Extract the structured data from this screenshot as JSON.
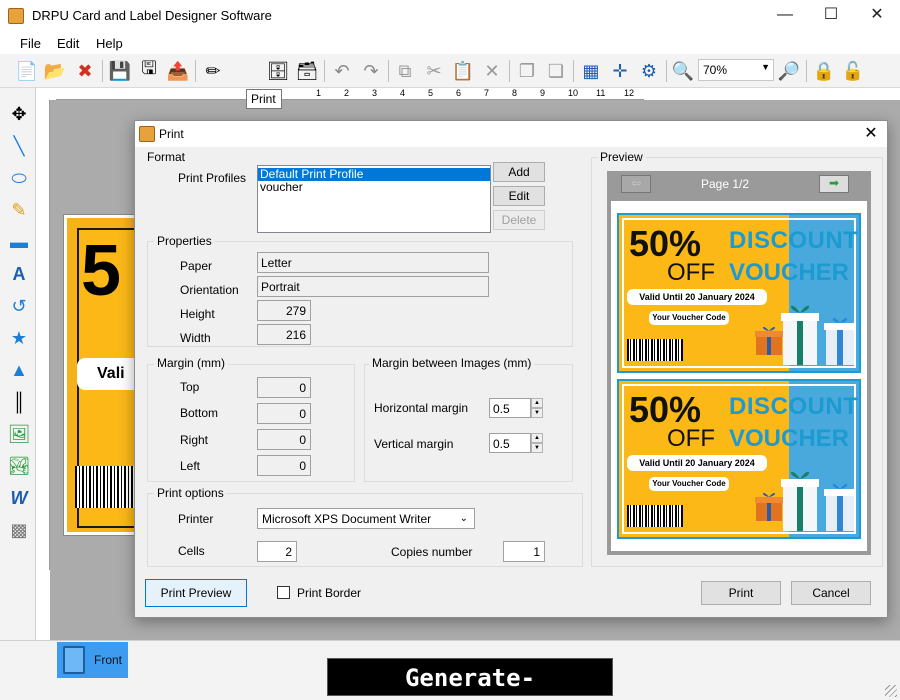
{
  "app": {
    "title": "DRPU Card and Label Designer Software",
    "minimize": "—",
    "maximize": "☐",
    "close": "✕"
  },
  "menu": [
    "File",
    "Edit",
    "Help"
  ],
  "toolbar": {
    "zoom_value": "70%",
    "tooltip": "Print",
    "icons": [
      "new-icon",
      "open-icon",
      "close-file-icon",
      "save-icon",
      "save-as-icon",
      "export-icon",
      "edit-icon",
      "print-icon",
      "database-add-icon",
      "database-icon",
      "undo-icon",
      "redo-icon",
      "copy-icon",
      "cut-icon",
      "paste-icon",
      "delete-icon",
      "bring-front-icon",
      "send-back-icon",
      "grid-icon",
      "center-icon",
      "settings-icon",
      "zoom-in-icon",
      "zoom-out-icon",
      "lock-icon",
      "unlock-icon"
    ]
  },
  "ruler": {
    "ticks": [
      "1",
      "2",
      "3",
      "4",
      "5",
      "6",
      "7",
      "8",
      "9",
      "10",
      "11",
      "12"
    ]
  },
  "canvas_card": {
    "big_text": "5",
    "pill_text": "Vali"
  },
  "bottom": {
    "front_tab": "Front",
    "banner": "Generate-Barcode.com"
  },
  "dialog": {
    "title": "Print",
    "format": {
      "group": "Format",
      "profiles_label": "Print Profiles",
      "profiles": [
        "Default Print Profile",
        "voucher"
      ],
      "selected_index": 0,
      "add": "Add",
      "edit": "Edit",
      "delete": "Delete"
    },
    "properties": {
      "group": "Properties",
      "paper_label": "Paper",
      "paper": "Letter",
      "orientation_label": "Orientation",
      "orientation": "Portrait",
      "height_label": "Height",
      "height": "279",
      "width_label": "Width",
      "width": "216"
    },
    "margin": {
      "group": "Margin (mm)",
      "top_label": "Top",
      "top": "0",
      "bottom_label": "Bottom",
      "bottom": "0",
      "right_label": "Right",
      "right": "0",
      "left_label": "Left",
      "left": "0"
    },
    "margin_images": {
      "group": "Margin between Images (mm)",
      "horizontal_label": "Horizontal margin",
      "horizontal": "0.5",
      "vertical_label": "Vertical margin",
      "vertical": "0.5"
    },
    "print_options": {
      "group": "Print options",
      "printer_label": "Printer",
      "printer": "Microsoft XPS Document Writer",
      "cells_label": "Cells",
      "cells": "2",
      "copies_label": "Copies number",
      "copies": "1"
    },
    "preview": {
      "group": "Preview",
      "page": "Page 1/2",
      "voucher": {
        "percent": "50%",
        "off": "OFF",
        "discount": "DISCOUNT",
        "voucher": "VOUCHER",
        "valid": "Valid Until 20 January 2024",
        "code": "Your Voucher Code"
      }
    },
    "buttons": {
      "print_preview": "Print Preview",
      "print_border": "Print Border",
      "print": "Print",
      "cancel": "Cancel"
    }
  }
}
